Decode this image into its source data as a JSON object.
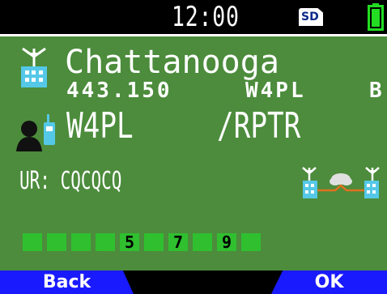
{
  "status_bar": {
    "time": "12:00",
    "sd_label": "SD",
    "battery_color": "#22dd22"
  },
  "memory": {
    "name": "Chattanooga",
    "frequency": "443.150",
    "repeater_call": "W4PL",
    "band": "B"
  },
  "caller": {
    "callsign": "W4PL",
    "suffix": "/RPTR"
  },
  "ur": {
    "label": "UR:",
    "value": "CQCQCQ"
  },
  "s_meter": {
    "segments": [
      "",
      "",
      "",
      "",
      "",
      "5",
      "",
      "7",
      "",
      "9"
    ],
    "color": "#2fbf2f"
  },
  "softkeys": {
    "left_label": "Back",
    "right_label": "OK",
    "color": "#1a1aff"
  },
  "icons": {
    "repeater": "repeater-icon",
    "caller": "person-radio-icon",
    "gateway": "gateway-network-icon",
    "sd": "sd-card-icon",
    "battery": "battery-icon"
  },
  "colors": {
    "background": "#4c8c3c",
    "text": "#ffffff",
    "status_bar": "#000000"
  }
}
